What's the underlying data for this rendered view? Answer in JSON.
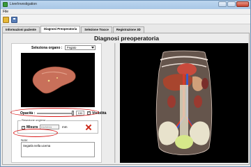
{
  "window": {
    "title": "LiverInvestigation"
  },
  "menu": {
    "file": "File"
  },
  "toolbar": {
    "open_icon": "folder-open-icon",
    "save_icon": "save-disk-icon"
  },
  "tabs": [
    {
      "label": "Informazioni paziente",
      "active": false
    },
    {
      "label": "Diagnosi Preoperatoria",
      "active": true
    },
    {
      "label": "Selezione Tracce",
      "active": false
    },
    {
      "label": "Registrazione 3D",
      "active": false
    }
  ],
  "page": {
    "heading": "Diagnosi preoperatoria"
  },
  "organ": {
    "label": "Seleziona organo :",
    "selected": "Fegato"
  },
  "opacity": {
    "label": "Opacità :",
    "value": "100",
    "visible_label": "Visibilità",
    "visible_checked": true
  },
  "resection": {
    "caption": "Resezione ungiena",
    "label": "Misura",
    "checked": true,
    "date": "01/02/11",
    "unit": "mm"
  },
  "notes": {
    "label": "Note:",
    "text": "Segarla nella ucema"
  },
  "colors": {
    "annotation": "#d81818",
    "viewport_bg": "#000000",
    "liver": "#c8705a"
  }
}
